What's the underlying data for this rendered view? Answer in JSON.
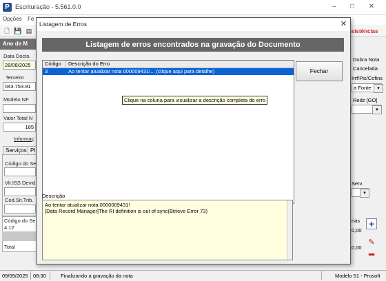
{
  "app": {
    "title": "Escrituração - 5.561.0.0",
    "icon_letter": "P",
    "menus": [
      "Opções",
      "Fe"
    ]
  },
  "header": {
    "inconsistencias": "nsistências",
    "ano": "Ano de M"
  },
  "left_form": {
    "data_docto_label": "Data Docto.",
    "data_docto_value": "28/08/2025",
    "terceiro_label": "Terceiro",
    "terceiro_value": "043.753.91",
    "modelo_nf_label": "Modelo NF",
    "valor_total_label": "Valor Total N",
    "valor_total_value": "185",
    "informacoes": "Informaç",
    "tab_servicos": "Serviços",
    "tab_pi": "PI",
    "codigo_se_label": "Código do Se",
    "vlr_iss_label": "Vlr.ISS Devid",
    "cod_sit_label": "Cod.Sit.Trib.",
    "codigo_se2_label": "Código do Se",
    "row_value": "4.12",
    "total_label": "Total"
  },
  "right_form": {
    "dobra_nota": "Dobra Nota",
    "cancelada": "Cancelada",
    "irrf": "Irrf/Pis/Cofins",
    "fonte": "a Fonte",
    "redz": "Redz [GO]",
    "serv": "Serv.",
    "rias": "rias",
    "val1": "0,00",
    "val2": "0,00"
  },
  "dialog": {
    "title": "Listagem de Erros",
    "banner": "Listagem de erros encontrados na gravação do Documento",
    "columns": [
      "Código",
      "Descrição do Erro"
    ],
    "rows": [
      {
        "codigo": "3",
        "descricao": "Ao tentar atualizar nota 000009431!... (clique aqui para detalhe)"
      }
    ],
    "tooltip": "Clique na coluna para visualizar a descrição completa do erro",
    "fechar": "Fechar",
    "descricao_label": "Descrição",
    "descricao_lines": [
      "Ao tentar atualizar nota 0000009431!",
      "[Data Record Manager]The RI definition is out of sync(Btrieve Error 73)"
    ]
  },
  "status": {
    "date": "09/09/2025",
    "time": "08:30",
    "message": "Finalizando a gravação da nota",
    "model": "Modelo 51 - Prosoft"
  }
}
